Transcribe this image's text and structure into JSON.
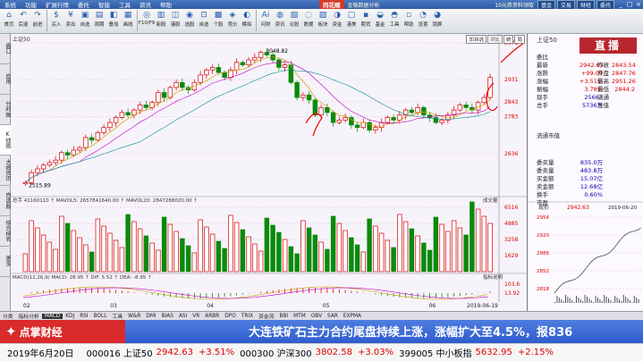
{
  "menu": {
    "items": [
      "系统",
      "功能",
      "扩展行情",
      "委托",
      "智能",
      "工具",
      "资讯",
      "帮助"
    ],
    "brand": "同花顺",
    "brand_sub": "金融数据分析",
    "ad": "10元券资料领取",
    "btns": [
      "基金",
      "交易"
    ],
    "right_btn": "财经",
    "right_btn2": "委托"
  },
  "toolbar": [
    {
      "icon": "⌂",
      "label": "首页"
    },
    {
      "icon": "↶",
      "label": "后退"
    },
    {
      "icon": "↷",
      "label": "前进"
    },
    {
      "icon": "$",
      "label": "买入"
    },
    {
      "icon": "¥",
      "label": "卖出"
    },
    {
      "icon": "▣",
      "label": "自选"
    },
    {
      "icon": "▤",
      "label": "周期"
    },
    {
      "icon": "◧",
      "label": "叠加"
    },
    {
      "icon": "▦",
      "label": "画线"
    },
    {
      "icon": "◎",
      "label": "F10/F9"
    },
    {
      "icon": "▥",
      "label": "新股"
    },
    {
      "icon": "◫",
      "label": "港股"
    },
    {
      "icon": "◉",
      "label": "选股"
    },
    {
      "icon": "⊡",
      "label": "自选"
    },
    {
      "icon": "▩",
      "label": "个股"
    },
    {
      "icon": "◈",
      "label": "竞价"
    },
    {
      "icon": "◐",
      "label": "模拟"
    },
    {
      "icon": "Ai",
      "label": "问财"
    },
    {
      "icon": "◍",
      "label": "资讯"
    },
    {
      "icon": "▧",
      "label": "论股"
    },
    {
      "icon": "◌",
      "label": "数据"
    },
    {
      "icon": "▨",
      "label": "板块"
    },
    {
      "icon": "◑",
      "label": "资金"
    },
    {
      "icon": "▢",
      "label": "港美"
    },
    {
      "icon": "▪",
      "label": "期货"
    },
    {
      "icon": "◒",
      "label": "基金"
    },
    {
      "icon": "◓",
      "label": "工具"
    },
    {
      "icon": "▫",
      "label": "帮助"
    },
    {
      "icon": "◔",
      "label": "设置"
    },
    {
      "icon": "◕",
      "label": "锁屏"
    }
  ],
  "left_tabs": [
    "盘口",
    "应用",
    "分时图",
    "K线图",
    "大盘资讯",
    "自选股",
    "综合排名",
    "更多"
  ],
  "chart": {
    "title": "上证50",
    "buttons": [
      "加自选",
      "对比",
      "统",
      "局"
    ],
    "high_label": "3048.82",
    "low_label": "2515.89",
    "y_ticks": [
      "3078",
      "2931",
      "2843",
      "2783",
      "2636"
    ],
    "vol_ticks": [
      "6516",
      "4885",
      "3258",
      "1629"
    ],
    "macd_ticks": [
      "103.6",
      "13.92"
    ],
    "x_ticks": [
      "02",
      "03",
      "04",
      "05",
      "06",
      "2019-06-19"
    ],
    "indicator_volume": "总手 41160110 ↑ MAVOL5: 2657841640.00 ↑ MAVOL20: 2847288020.00 ↑",
    "indicator_macd": "MACD(12,26,9) MACD: 28.95 ↑ DIF: 5.52 ↑ DEA: -8.95 ↑",
    "vol_dropdown": "成交量",
    "macd_btn": "指标说明"
  },
  "chart_data": {
    "type": "candlestick",
    "title": "上证50",
    "x_ticks": [
      "02",
      "03",
      "04",
      "05",
      "06"
    ],
    "ylim": [
      2500,
      3078
    ],
    "high": 3048.82,
    "low": 2515.89,
    "closes": [
      2520,
      2560,
      2575,
      2590,
      2600,
      2610,
      2640,
      2630,
      2650,
      2660,
      2700,
      2690,
      2720,
      2740,
      2760,
      2780,
      2800,
      2790,
      2810,
      2830,
      2820,
      2840,
      2880,
      2860,
      2900,
      2920,
      2900,
      2890,
      2920,
      2950,
      2970,
      2980,
      2960,
      2940,
      2970,
      3000,
      2990,
      3010,
      3020,
      3040,
      3030,
      3010,
      2980,
      2990,
      2920,
      2860,
      2870,
      2850,
      2790,
      2820,
      2800,
      2760,
      2770,
      2780,
      2750,
      2740,
      2760,
      2730,
      2740,
      2760,
      2780,
      2770,
      2790,
      2810,
      2800,
      2820,
      2790,
      2780,
      2760,
      2770,
      2790,
      2810,
      2830,
      2820,
      2810,
      2840,
      2860,
      2940
    ]
  },
  "right": {
    "title": "上证50",
    "live": "直播",
    "rows": [
      {
        "l": "委比",
        "v": "",
        "c": "red"
      },
      {
        "l": "最新",
        "v": "2942.63",
        "c": "red"
      },
      {
        "l": "涨跌",
        "v": "+99.09",
        "c": "red"
      },
      {
        "l": "涨幅",
        "v": "+3.51%",
        "c": "red"
      },
      {
        "l": "振幅",
        "v": "3.78%",
        "c": "red"
      },
      {
        "l": "现手",
        "v": "25667",
        "c": "blu"
      },
      {
        "l": "总手",
        "v": "5736万",
        "c": "blu"
      },
      {
        "l": "流通市值",
        "v": "",
        "c": "blu"
      },
      {
        "l": "委买量",
        "v": "835.0万",
        "c": "blu"
      },
      {
        "l": "委卖量",
        "v": "483.8万",
        "c": "blu"
      },
      {
        "l": "买金额",
        "v": "15.07亿",
        "c": "blu"
      },
      {
        "l": "卖金额",
        "v": "12.68亿",
        "c": "blu"
      },
      {
        "l": "换手",
        "v": "0.60%",
        "c": "blu"
      },
      {
        "l": "市盈",
        "v": "",
        "c": "blu"
      }
    ],
    "right_col": [
      {
        "l": "昨收",
        "v": "2843.54"
      },
      {
        "l": "开盘",
        "v": "2847.76"
      },
      {
        "l": "最高",
        "v": "2951.26"
      },
      {
        "l": "最低",
        "v": "2844.2"
      },
      {
        "l": "流通",
        "v": ""
      },
      {
        "l": "总值",
        "v": ""
      }
    ],
    "mini_label": "现价",
    "mini_price": "2942.63",
    "mini_date": "2019-06-20",
    "mini_ticks": [
      "2954",
      "2920",
      "2886",
      "2852",
      "2818"
    ]
  },
  "bottom_tabs": [
    "分类",
    "指标分析",
    "MACD",
    "KDJ",
    "RSI",
    "BOLL",
    "工具",
    "W&R",
    "DMI",
    "BIAS",
    "ASI",
    "VR",
    "ARBR",
    "DPO",
    "TRIX",
    "资金流",
    "BBI",
    "MTM",
    "OBV",
    "SAR",
    "EXPMA"
  ],
  "banner": {
    "logo": "点掌财经",
    "headline": "大连铁矿石主力合约尾盘持续上涨，涨幅扩大至4.5%，报836"
  },
  "ticker": {
    "date": "2019年6月20日",
    "items": [
      {
        "code": "000016 上证50",
        "price": "2942.63",
        "pct": "+3.51%"
      },
      {
        "code": "000300 沪深300",
        "price": "3802.58",
        "pct": "+3.03%"
      },
      {
        "code": "399005 中小板指",
        "price": "5632.95",
        "pct": "+2.15%"
      }
    ]
  },
  "colors": {
    "up": "#d40000",
    "down": "#0a8a0a",
    "accent": "#d92b2b",
    "banner": "#2e5ccd"
  }
}
